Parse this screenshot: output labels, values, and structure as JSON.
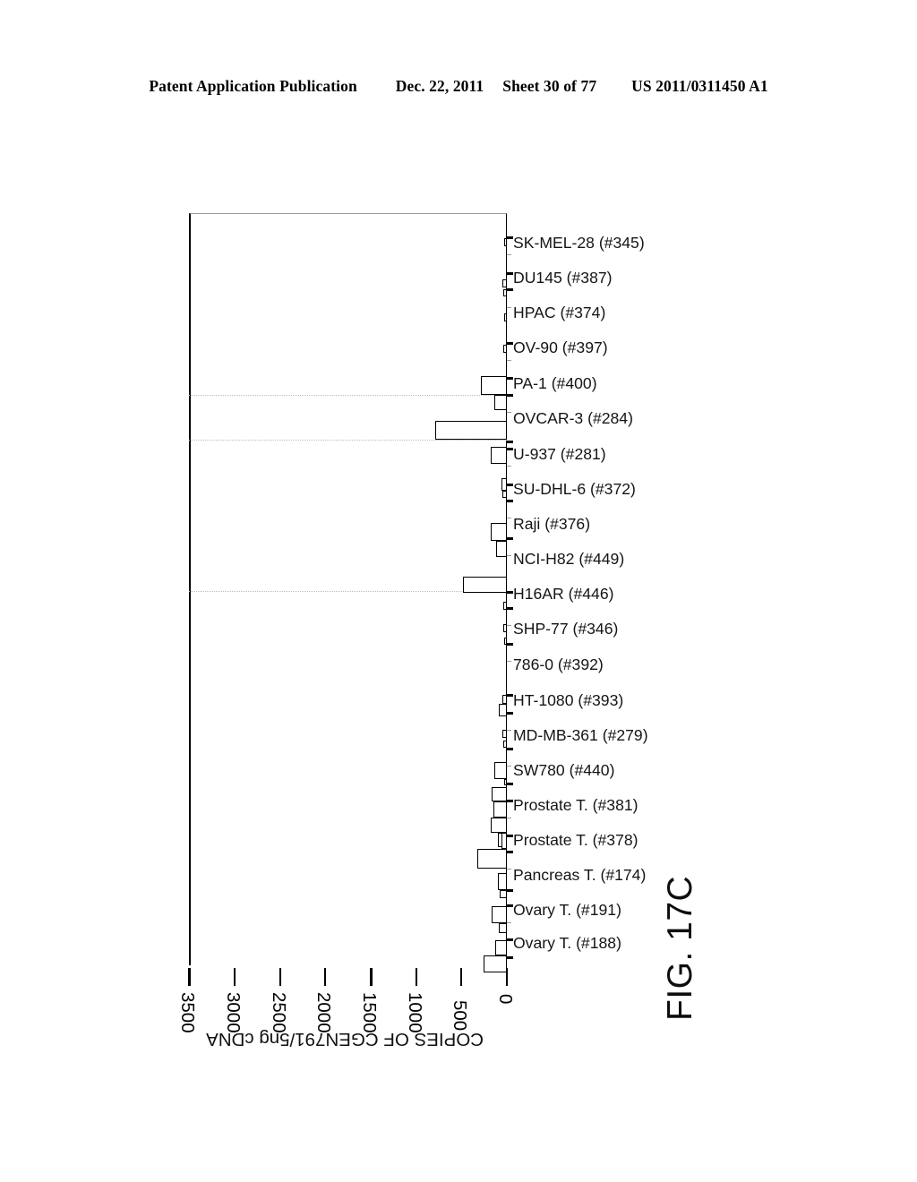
{
  "header": {
    "publication": "Patent Application Publication",
    "date": "Dec. 22, 2011",
    "sheet": "Sheet 30 of 77",
    "patent_number": "US 2011/0311450 A1"
  },
  "figure": {
    "caption": "FIG. 17C"
  },
  "chart_data": {
    "type": "bar",
    "orientation": "horizontal-reversed",
    "title": "",
    "xlabel": "COPIES OF CGEN791/5ng cDNA",
    "ylabel": "",
    "axis_title": "COPIES OF CGEN791/5ng cDNA",
    "tick_labels": [
      "3500",
      "3000",
      "2500",
      "2000",
      "1500",
      "1000",
      "500",
      "0"
    ],
    "tick_values": [
      3500,
      3000,
      2500,
      2000,
      1500,
      1000,
      500,
      0
    ],
    "xlim": [
      0,
      3500
    ],
    "grid": false,
    "legend": "none",
    "categories": [
      "SK-MEL-28 (#345)",
      "DU145 (#387)",
      "HPAC (#374)",
      "OV-90 (#397)",
      "PA-1 (#400)",
      "OVCAR-3 (#284)",
      "U-937 (#281)",
      "SU-DHL-6 (#372)",
      "Raji (#376)",
      "NCI-H82 (#449)",
      "H16AR (#446)",
      "SHP-77 (#346)",
      "786-0 (#392)",
      "HT-1080 (#393)",
      "MD-MB-361 (#279)",
      "SW780 (#440)",
      "Prostate T. (#381)",
      "Prostate T. (#378)",
      "Pancreas T. (#174)",
      "Ovary T. (#191)",
      "Ovary T. (#188)"
    ],
    "values": [
      2,
      4,
      2,
      5,
      286,
      62,
      790,
      120,
      18,
      150,
      100,
      485,
      10,
      6,
      8,
      4,
      55,
      14,
      100,
      36,
      120,
      95,
      160,
      48,
      330,
      40,
      20,
      110,
      30,
      45,
      150
    ],
    "bars": [
      {
        "label": "SK-MEL-28 (#345)",
        "value": 0
      },
      {
        "label": "DU145 (#387)",
        "value": 0
      },
      {
        "label": "HPAC (#374)",
        "value": 0
      },
      {
        "label": "OV-90 (#397)",
        "value": 0
      },
      {
        "label": "PA-1 (#400)",
        "value": 286
      },
      {
        "label": "PA-1 (#400) b",
        "value": 62
      },
      {
        "label": "OVCAR-3 (#284)",
        "value": 790
      },
      {
        "label": "U-937 (#281)",
        "value": 120
      },
      {
        "label": "SU-DHL-6 (#372)",
        "value": 45
      },
      {
        "label": "Raji (#376)",
        "value": 150
      },
      {
        "label": "NCI-H82 (#449)",
        "value": 100
      },
      {
        "label": "H16AR (#446)",
        "value": 485
      },
      {
        "label": "SHP-77 (#346)",
        "value": 0
      },
      {
        "label": "786-0 (#392)",
        "value": 0
      },
      {
        "label": "HT-1080 (#393)",
        "value": 48
      },
      {
        "label": "MD-MB-361 (#279)",
        "value": 0
      },
      {
        "label": "SW780 (#440)",
        "value": 110
      },
      {
        "label": "SW780 (#440) b",
        "value": 130
      },
      {
        "label": "Prostate T. (#381)",
        "value": 120
      },
      {
        "label": "Prostate T. (#381) b",
        "value": 145
      },
      {
        "label": "Prostate T. (#378)",
        "value": 90
      },
      {
        "label": "Prostate T. (#378) b",
        "value": 330
      },
      {
        "label": "Pancreas T. (#174)",
        "value": 80
      },
      {
        "label": "Pancreas T. (#174) b",
        "value": 60
      },
      {
        "label": "Ovary T. (#191)",
        "value": 130
      },
      {
        "label": "Ovary T. (#191) b",
        "value": 60
      },
      {
        "label": "Ovary T. (#188)",
        "value": 95
      },
      {
        "label": "Ovary T. (#188) b",
        "value": 250
      }
    ]
  },
  "colors": {
    "bar_fill": "#ffffff",
    "bar_stroke": "#000000",
    "axis": "#000000",
    "text": "#000000"
  }
}
